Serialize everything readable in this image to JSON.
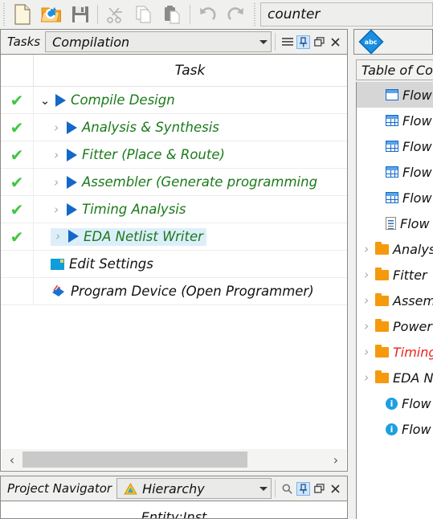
{
  "toolbar": {
    "buttons": [
      {
        "name": "new-file-icon",
        "label": "New",
        "enabled": true
      },
      {
        "name": "open-folder-icon",
        "label": "Open",
        "enabled": true
      },
      {
        "name": "save-icon",
        "label": "Save",
        "enabled": true
      },
      {
        "name": "cut-icon",
        "label": "Cut",
        "enabled": false
      },
      {
        "name": "copy-icon",
        "label": "Copy",
        "enabled": false
      },
      {
        "name": "paste-icon",
        "label": "Paste",
        "enabled": false
      },
      {
        "name": "undo-icon",
        "label": "Undo",
        "enabled": false
      },
      {
        "name": "redo-icon",
        "label": "Redo",
        "enabled": false
      }
    ],
    "project_field": {
      "value": "counter",
      "placeholder": ""
    }
  },
  "tasks_panel": {
    "title": "Tasks",
    "flow_selector": {
      "value": "Compilation"
    },
    "header_icons": {
      "menu": "hamburger-icon",
      "pin": "pin-icon",
      "float": "float-icon",
      "close": "close-icon"
    },
    "column_header": "Task",
    "rows": [
      {
        "check": true,
        "indent": 0,
        "expander": "down",
        "icon": "play-arrow-icon",
        "label": "Compile Design",
        "color": "green",
        "selected": false
      },
      {
        "check": true,
        "indent": 1,
        "expander": "right",
        "icon": "play-arrow-icon",
        "label": "Analysis & Synthesis",
        "color": "green",
        "selected": false
      },
      {
        "check": true,
        "indent": 1,
        "expander": "right",
        "icon": "play-arrow-icon",
        "label": "Fitter (Place & Route)",
        "color": "green",
        "selected": false
      },
      {
        "check": true,
        "indent": 1,
        "expander": "right",
        "icon": "play-arrow-icon",
        "label": "Assembler (Generate programming",
        "color": "green",
        "selected": false
      },
      {
        "check": true,
        "indent": 1,
        "expander": "right",
        "icon": "play-arrow-icon",
        "label": "Timing Analysis",
        "color": "green",
        "selected": false
      },
      {
        "check": true,
        "indent": 1,
        "expander": "right",
        "icon": "play-arrow-icon",
        "label": "EDA Netlist Writer",
        "color": "green",
        "selected": true
      },
      {
        "check": false,
        "indent": 1,
        "expander": "none",
        "icon": "settings-icon",
        "label": "Edit Settings",
        "color": "black",
        "selected": false
      },
      {
        "check": false,
        "indent": 1,
        "expander": "none",
        "icon": "programmer-icon",
        "label": "Program Device (Open Programmer)",
        "color": "black",
        "selected": false
      }
    ],
    "scrollbar": {
      "left_arrow": "‹",
      "right_arrow": "›"
    }
  },
  "project_navigator": {
    "title": "Project Navigator",
    "view_selector": {
      "value": "Hierarchy",
      "icon": "hierarchy-icon"
    },
    "header_icons": {
      "search": "search-icon",
      "pin": "pin-icon",
      "float": "float-icon",
      "close": "close-icon"
    },
    "column_header": "Entity:Inst"
  },
  "report_panel": {
    "tab_icon": "abc-spellcheck-icon",
    "header": "Table of Co",
    "rows": [
      {
        "indent": 1,
        "expander": "none",
        "icon": "table-icon",
        "label": "Flow S",
        "color": "black",
        "selected": true
      },
      {
        "indent": 1,
        "expander": "none",
        "icon": "table-icon",
        "label": "Flow S",
        "color": "black",
        "selected": false
      },
      {
        "indent": 1,
        "expander": "none",
        "icon": "table-icon",
        "label": "Flow N",
        "color": "black",
        "selected": false
      },
      {
        "indent": 1,
        "expander": "none",
        "icon": "table-icon",
        "label": "Flow E",
        "color": "black",
        "selected": false
      },
      {
        "indent": 1,
        "expander": "none",
        "icon": "table-icon",
        "label": "Flow C",
        "color": "black",
        "selected": false
      },
      {
        "indent": 1,
        "expander": "none",
        "icon": "document-icon",
        "label": "Flow L",
        "color": "black",
        "selected": false
      },
      {
        "indent": 0,
        "expander": "right",
        "icon": "folder-icon",
        "label": "Analys",
        "color": "black",
        "selected": false
      },
      {
        "indent": 0,
        "expander": "right",
        "icon": "folder-icon",
        "label": "Fitter",
        "color": "black",
        "selected": false
      },
      {
        "indent": 0,
        "expander": "right",
        "icon": "folder-icon",
        "label": "Assem",
        "color": "black",
        "selected": false
      },
      {
        "indent": 0,
        "expander": "right",
        "icon": "folder-icon",
        "label": "Power",
        "color": "black",
        "selected": false
      },
      {
        "indent": 0,
        "expander": "right",
        "icon": "folder-icon",
        "label": "Timing",
        "color": "red",
        "selected": false
      },
      {
        "indent": 0,
        "expander": "right",
        "icon": "folder-icon",
        "label": "EDA N",
        "color": "black",
        "selected": false
      },
      {
        "indent": 1,
        "expander": "none",
        "icon": "info-icon",
        "label": "Flow N",
        "color": "black",
        "selected": false
      },
      {
        "indent": 1,
        "expander": "none",
        "icon": "info-icon",
        "label": "Flow S",
        "color": "black",
        "selected": false
      }
    ]
  },
  "colors": {
    "task_green": "#1b7a1b",
    "check_green": "#3ec73e",
    "play_blue": "#1468c8",
    "folder_orange": "#f59a0c",
    "error_red": "#e8241c",
    "selection_blue": "#ddeefb",
    "selection_grey": "#d6d6d6",
    "panel_bg": "#f0f0ef"
  }
}
